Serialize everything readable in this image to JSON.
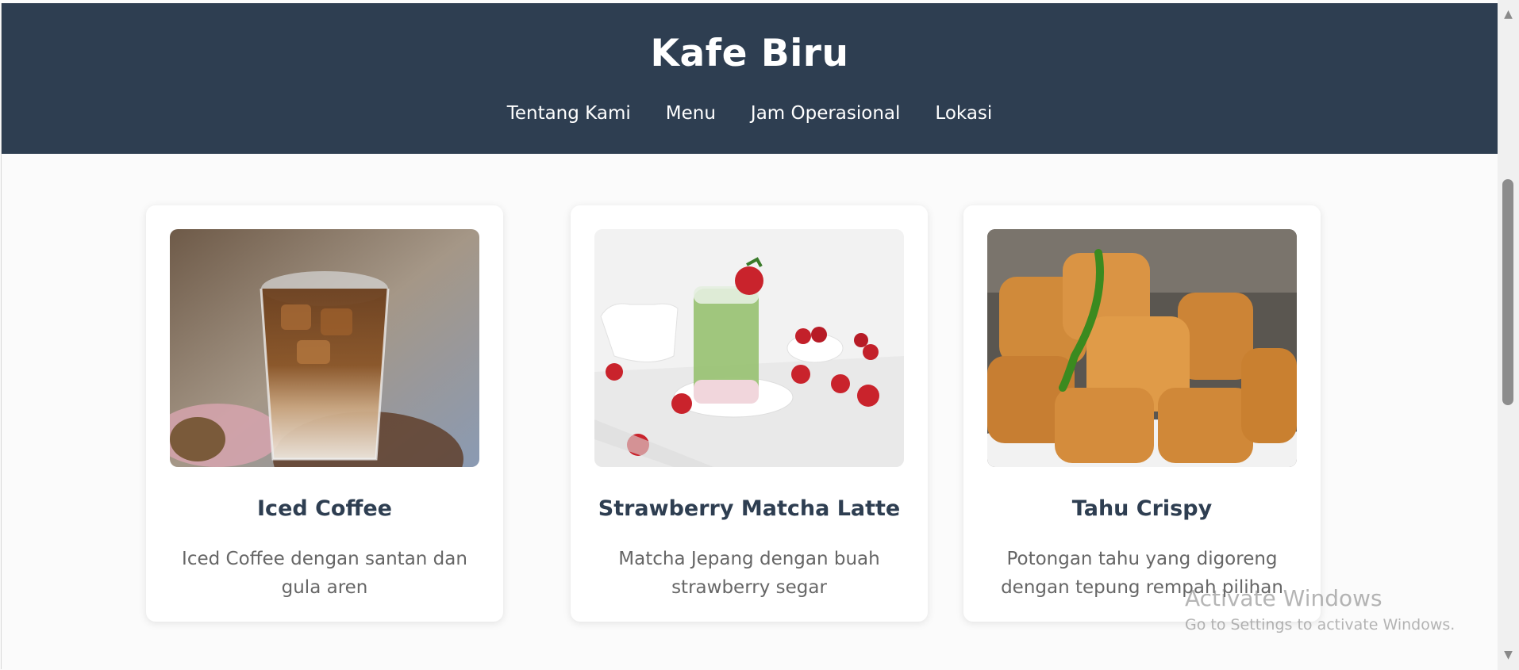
{
  "header": {
    "title": "Kafe Biru",
    "nav": [
      {
        "label": "Tentang Kami"
      },
      {
        "label": "Menu"
      },
      {
        "label": "Jam Operasional"
      },
      {
        "label": "Lokasi"
      }
    ]
  },
  "menu": {
    "items": [
      {
        "title": "Iced Coffee",
        "description": "Iced Coffee dengan santan dan gula aren",
        "image": "iced-coffee-photo"
      },
      {
        "title": "Strawberry Matcha Latte",
        "description": "Matcha Jepang dengan buah strawberry segar",
        "image": "strawberry-matcha-latte-photo"
      },
      {
        "title": "Tahu Crispy",
        "description": "Potongan tahu yang digoreng dengan tepung rempah pilihan",
        "image": "tahu-crispy-photo"
      }
    ]
  },
  "watermark": {
    "line1": "Activate Windows",
    "line2": "Go to Settings to activate Windows."
  },
  "scrollbar": {
    "up_icon": "triangle-up-icon",
    "down_icon": "triangle-down-icon"
  },
  "colors": {
    "header_bg": "#2e3e51",
    "title_text": "#ffffff",
    "card_title": "#2e3e51",
    "card_text": "#666666"
  }
}
